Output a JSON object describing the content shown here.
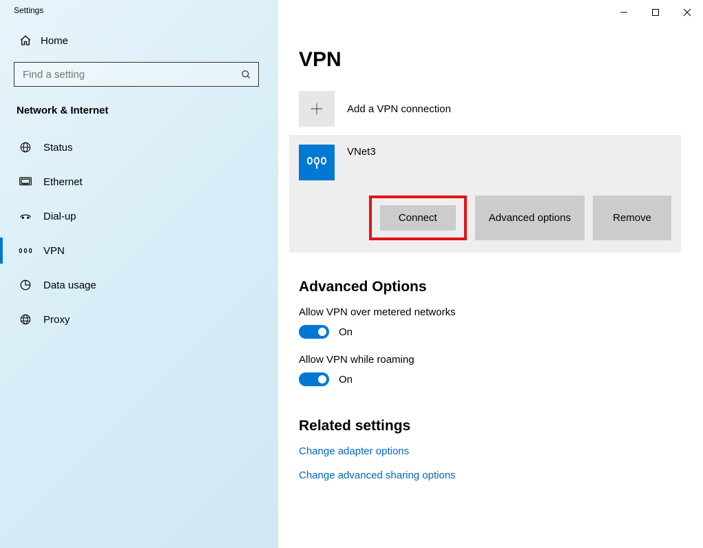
{
  "window": {
    "title": "Settings"
  },
  "sidebar": {
    "home": "Home",
    "search_placeholder": "Find a setting",
    "section": "Network & Internet",
    "items": [
      {
        "label": "Status"
      },
      {
        "label": "Ethernet"
      },
      {
        "label": "Dial-up"
      },
      {
        "label": "VPN"
      },
      {
        "label": "Data usage"
      },
      {
        "label": "Proxy"
      }
    ]
  },
  "page": {
    "heading": "VPN",
    "add_label": "Add a VPN connection",
    "vpn": {
      "name": "VNet3",
      "connect": "Connect",
      "advanced": "Advanced options",
      "remove": "Remove"
    },
    "adv_heading": "Advanced Options",
    "opt_metered": {
      "label": "Allow VPN over metered networks",
      "state": "On"
    },
    "opt_roaming": {
      "label": "Allow VPN while roaming",
      "state": "On"
    },
    "related_heading": "Related settings",
    "link_adapter": "Change adapter options",
    "link_sharing": "Change advanced sharing options"
  }
}
